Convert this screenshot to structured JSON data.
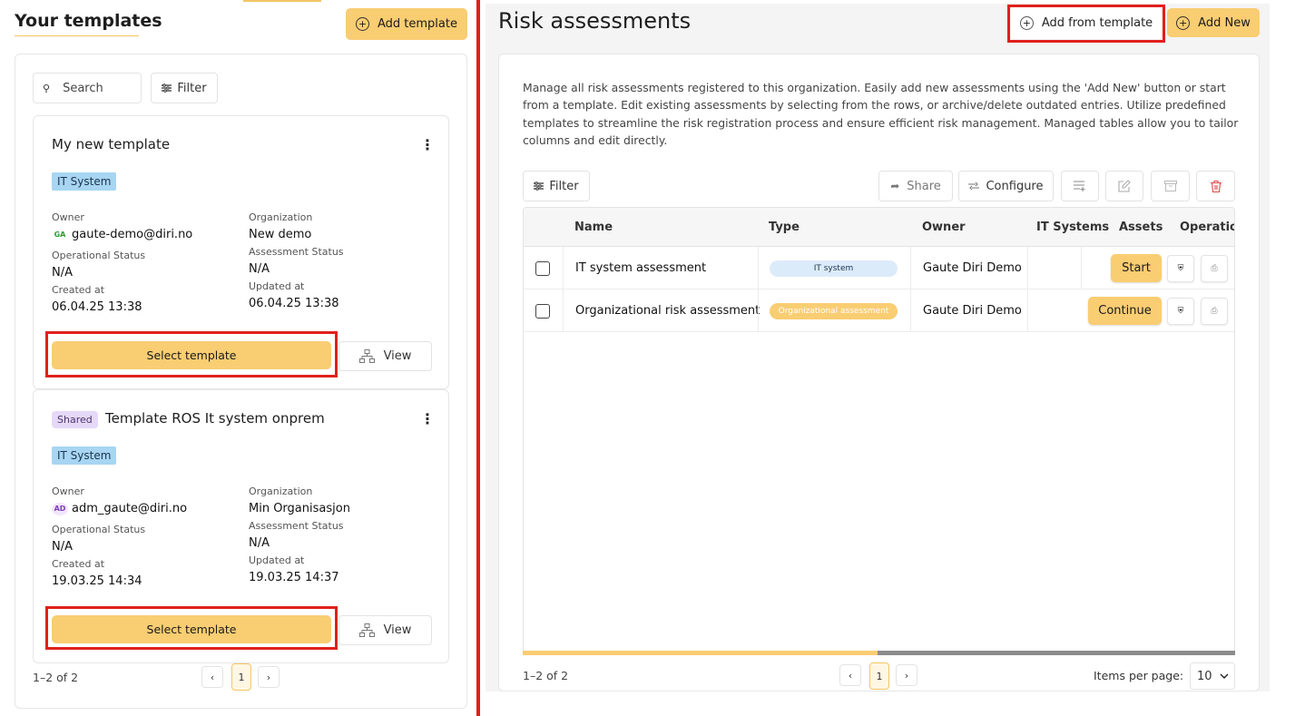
{
  "left": {
    "title": "Your templates",
    "add_template_label": "Add template",
    "search_placeholder": "Search",
    "filter_label": "Filter",
    "cards": [
      {
        "shared_label": "",
        "title": "My new template",
        "tag": "IT System",
        "owner_label": "Owner",
        "owner_initials": "GA",
        "owner": "gaute-demo@diri.no",
        "org_label": "Organization",
        "org": "New demo",
        "op_status_label": "Operational Status",
        "op_status": "N/A",
        "assess_status_label": "Assessment Status",
        "assess_status": "N/A",
        "created_label": "Created at",
        "created": "06.04.25 13:38",
        "updated_label": "Updated at",
        "updated": "06.04.25 13:38",
        "select_label": "Select template",
        "view_label": "View"
      },
      {
        "shared_label": "Shared",
        "title": "Template ROS It system onprem",
        "tag": "IT System",
        "owner_label": "Owner",
        "owner_initials": "AD",
        "owner": "adm_gaute@diri.no",
        "org_label": "Organization",
        "org": "Min Organisasjon",
        "op_status_label": "Operational Status",
        "op_status": "N/A",
        "assess_status_label": "Assessment Status",
        "assess_status": "N/A",
        "created_label": "Created at",
        "created": "19.03.25 14:34",
        "updated_label": "Updated at",
        "updated": "19.03.25 14:37",
        "select_label": "Select template",
        "view_label": "View"
      }
    ],
    "pagination": {
      "range": "1–2 of 2",
      "page": "1",
      "prev": "‹",
      "next": "›"
    }
  },
  "right": {
    "title": "Risk assessments",
    "add_from_template_label": "Add from template",
    "add_new_label": "Add New",
    "description": "Manage all risk assessments registered to this organization. Easily add new assessments using the 'Add New' button or start from a template. Edit existing assessments by selecting from the rows, or archive/delete outdated entries. Utilize predefined templates to streamline the risk registration process and ensure efficient risk management. Managed tables allow you to tailor columns and edit directly.",
    "toolbar": {
      "filter": "Filter",
      "share": "Share",
      "configure": "Configure"
    },
    "columns": [
      "Name",
      "Type",
      "Owner",
      "IT Systems",
      "Assets",
      "Operation"
    ],
    "rows": [
      {
        "name": "IT system assessment",
        "type": "IT system",
        "owner": "Gaute Diri Demo",
        "action": "Start"
      },
      {
        "name": "Organizational risk assessment",
        "type": "Organizational assessment",
        "owner": "Gaute Diri Demo",
        "action": "Continue"
      }
    ],
    "pagination": {
      "range": "1–2 of 2",
      "page": "1",
      "prev": "‹",
      "next": "›",
      "items_per_page_label": "Items per page:",
      "items_per_page": "10"
    }
  },
  "colors": {
    "accent": "#f9cd72",
    "highlight": "#e0201b",
    "tag_blue": "#a7d5f2",
    "danger": "#e04a4a"
  }
}
